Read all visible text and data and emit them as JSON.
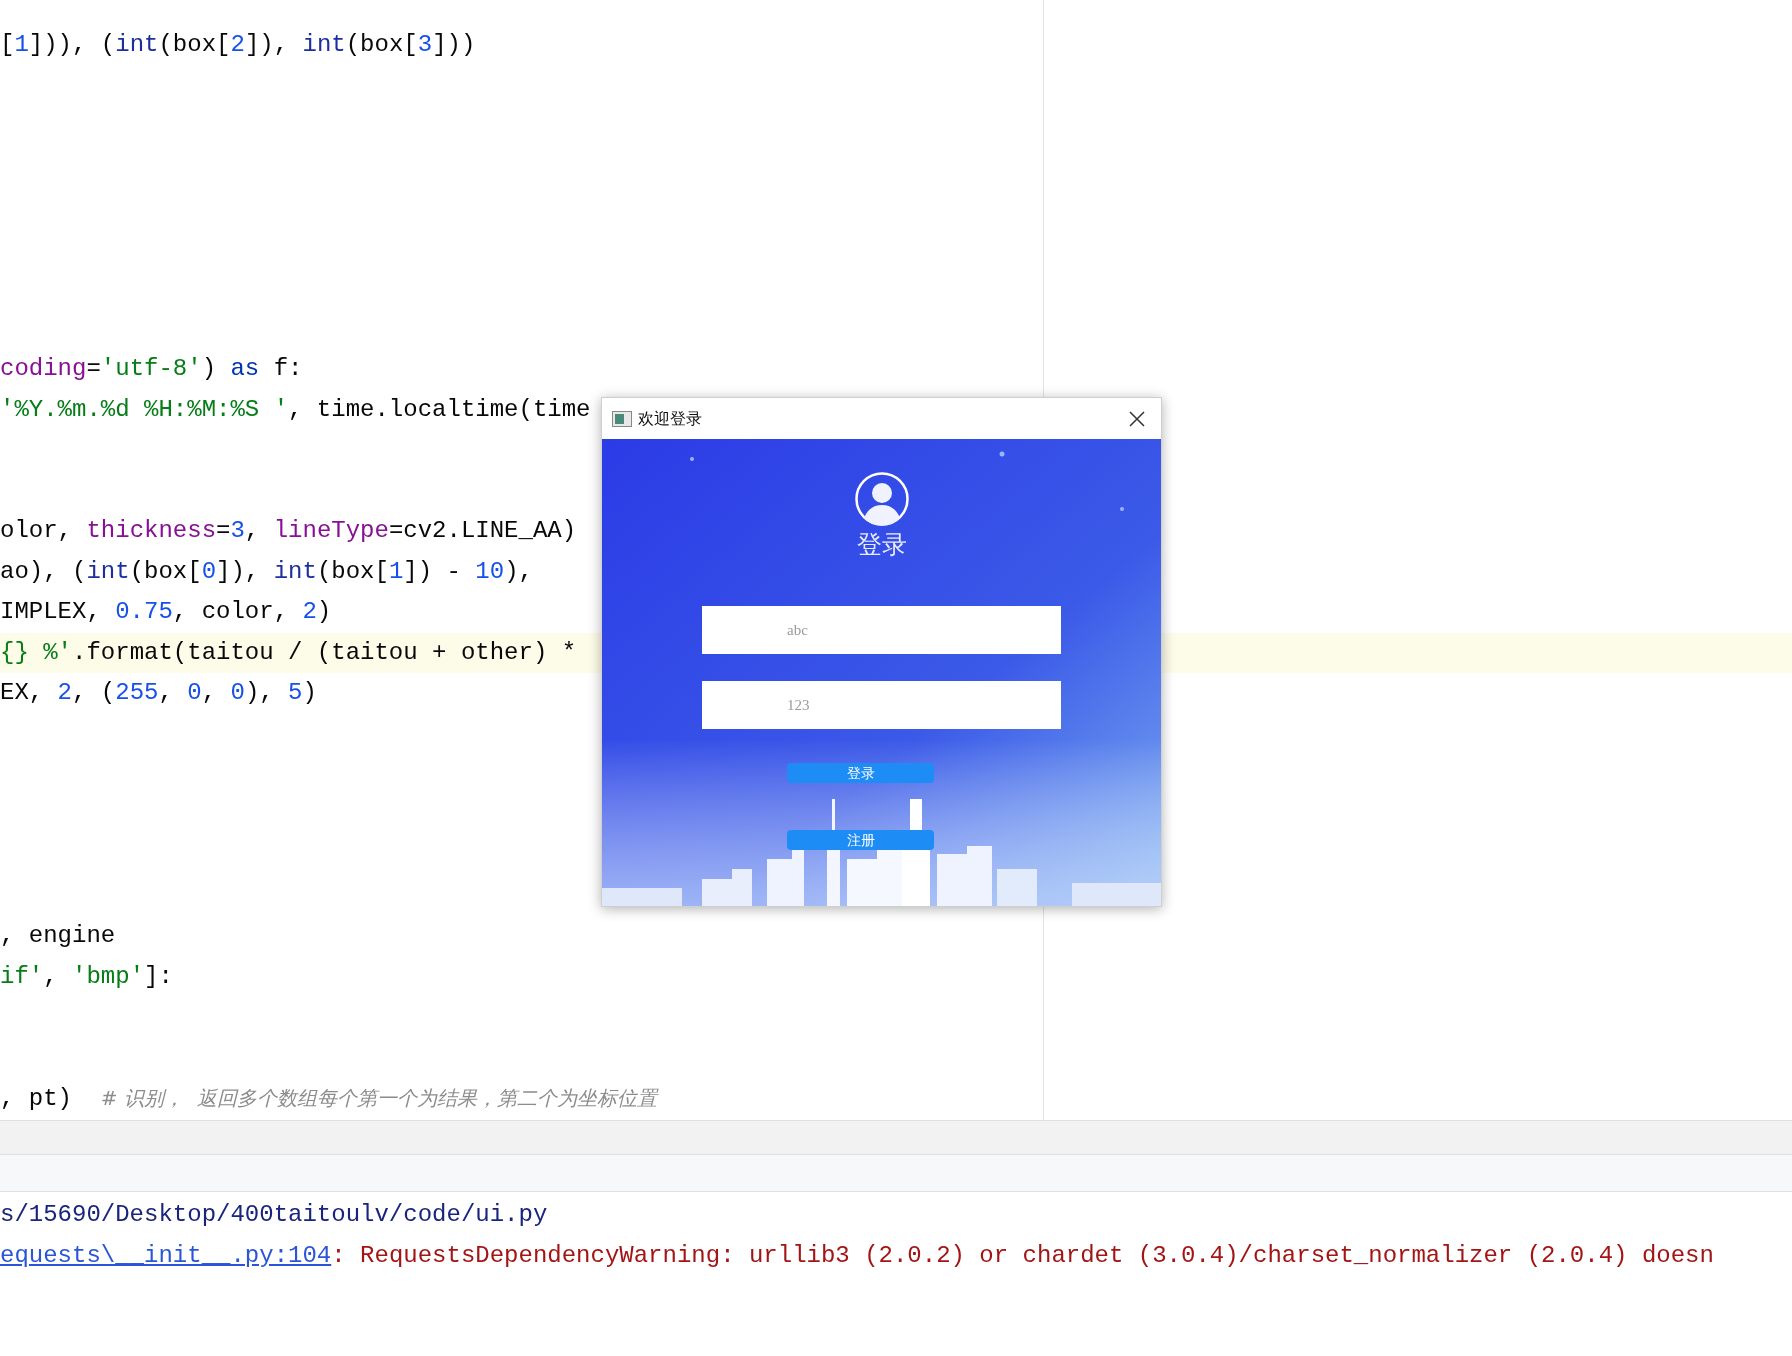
{
  "editor": {
    "lines": [
      {
        "kind": "code",
        "tokens": [
          {
            "text": "[",
            "kind": "plain"
          },
          {
            "text": "1",
            "kind": "number"
          },
          {
            "text": "])), (",
            "kind": "plain"
          },
          {
            "text": "int",
            "kind": "builtin"
          },
          {
            "text": "(box[",
            "kind": "plain"
          },
          {
            "text": "2",
            "kind": "number"
          },
          {
            "text": "]), ",
            "kind": "plain"
          },
          {
            "text": "int",
            "kind": "builtin"
          },
          {
            "text": "(box[",
            "kind": "plain"
          },
          {
            "text": "3",
            "kind": "number"
          },
          {
            "text": "]))",
            "kind": "plain"
          }
        ],
        "highlighted": false
      },
      {
        "kind": "blank"
      },
      {
        "kind": "blank"
      },
      {
        "kind": "blank"
      },
      {
        "kind": "blank"
      },
      {
        "kind": "blank"
      },
      {
        "kind": "blank"
      },
      {
        "kind": "blank"
      },
      {
        "kind": "code",
        "tokens": [
          {
            "text": "coding",
            "kind": "param"
          },
          {
            "text": "=",
            "kind": "plain"
          },
          {
            "text": "'utf-8'",
            "kind": "string"
          },
          {
            "text": ") ",
            "kind": "plain"
          },
          {
            "text": "as",
            "kind": "keyword"
          },
          {
            "text": " f:",
            "kind": "plain"
          }
        ],
        "highlighted": false
      },
      {
        "kind": "code",
        "tokens": [
          {
            "text": "'%Y.%m.%d %H:%M:%S '",
            "kind": "string"
          },
          {
            "text": ", time.localtime(time",
            "kind": "plain"
          }
        ],
        "highlighted": false
      },
      {
        "kind": "blank"
      },
      {
        "kind": "blank"
      },
      {
        "kind": "code",
        "tokens": [
          {
            "text": "olor, ",
            "kind": "plain"
          },
          {
            "text": "thickness",
            "kind": "param"
          },
          {
            "text": "=",
            "kind": "plain"
          },
          {
            "text": "3",
            "kind": "number"
          },
          {
            "text": ", ",
            "kind": "plain"
          },
          {
            "text": "lineType",
            "kind": "param"
          },
          {
            "text": "=cv2.LINE_AA)",
            "kind": "plain"
          }
        ],
        "highlighted": false
      },
      {
        "kind": "code",
        "tokens": [
          {
            "text": "ao), (",
            "kind": "plain"
          },
          {
            "text": "int",
            "kind": "builtin"
          },
          {
            "text": "(box[",
            "kind": "plain"
          },
          {
            "text": "0",
            "kind": "number"
          },
          {
            "text": "]), ",
            "kind": "plain"
          },
          {
            "text": "int",
            "kind": "builtin"
          },
          {
            "text": "(box[",
            "kind": "plain"
          },
          {
            "text": "1",
            "kind": "number"
          },
          {
            "text": "]) - ",
            "kind": "plain"
          },
          {
            "text": "10",
            "kind": "number"
          },
          {
            "text": "),",
            "kind": "plain"
          }
        ],
        "highlighted": false
      },
      {
        "kind": "code",
        "tokens": [
          {
            "text": "IMPLEX, ",
            "kind": "plain"
          },
          {
            "text": "0.75",
            "kind": "number"
          },
          {
            "text": ", color, ",
            "kind": "plain"
          },
          {
            "text": "2",
            "kind": "number"
          },
          {
            "text": ")",
            "kind": "plain"
          }
        ],
        "highlighted": false
      },
      {
        "kind": "code",
        "tokens": [
          {
            "text": "{} %'",
            "kind": "string"
          },
          {
            "text": ".format(taitou / (taitou + other) *",
            "kind": "plain"
          }
        ],
        "highlighted": true
      },
      {
        "kind": "code",
        "tokens": [
          {
            "text": "EX, ",
            "kind": "plain"
          },
          {
            "text": "2",
            "kind": "number"
          },
          {
            "text": ", (",
            "kind": "plain"
          },
          {
            "text": "255",
            "kind": "number"
          },
          {
            "text": ", ",
            "kind": "plain"
          },
          {
            "text": "0",
            "kind": "number"
          },
          {
            "text": ", ",
            "kind": "plain"
          },
          {
            "text": "0",
            "kind": "number"
          },
          {
            "text": "), ",
            "kind": "plain"
          },
          {
            "text": "5",
            "kind": "number"
          },
          {
            "text": ")",
            "kind": "plain"
          }
        ],
        "highlighted": false
      },
      {
        "kind": "blank"
      },
      {
        "kind": "blank"
      },
      {
        "kind": "blank"
      },
      {
        "kind": "blank"
      },
      {
        "kind": "blank"
      },
      {
        "kind": "code",
        "tokens": [
          {
            "text": ", engine",
            "kind": "plain"
          }
        ],
        "highlighted": false
      },
      {
        "kind": "code",
        "tokens": [
          {
            "text": "if'",
            "kind": "string"
          },
          {
            "text": ", ",
            "kind": "plain"
          },
          {
            "text": "'bmp'",
            "kind": "string"
          },
          {
            "text": "]:",
            "kind": "plain"
          }
        ],
        "highlighted": false
      },
      {
        "kind": "blank"
      },
      {
        "kind": "blank"
      },
      {
        "kind": "code",
        "tokens": [
          {
            "text": ", pt)  ",
            "kind": "plain"
          },
          {
            "text": "# 识别，  返回多个数组每个第一个为结果，第二个为坐标位置",
            "kind": "comment"
          }
        ],
        "highlighted": false
      }
    ]
  },
  "console": {
    "lines": [
      {
        "tokens": [
          {
            "text": "s/15690/Desktop/400taitoulv/code/ui.py",
            "kind": "path"
          }
        ]
      },
      {
        "tokens": [
          {
            "text": "equests\\__init__.py:104",
            "kind": "link"
          },
          {
            "text": ": RequestsDependencyWarning: urllib3 (2.0.2) or chardet (3.0.4)/charset_normalizer (2.0.4) doesn",
            "kind": "error"
          }
        ]
      }
    ]
  },
  "dialog": {
    "title": "欢迎登录",
    "heading": "登录",
    "fields": [
      {
        "value": "abc"
      },
      {
        "value": "123"
      }
    ],
    "buttons": [
      "登录",
      "注册"
    ]
  }
}
